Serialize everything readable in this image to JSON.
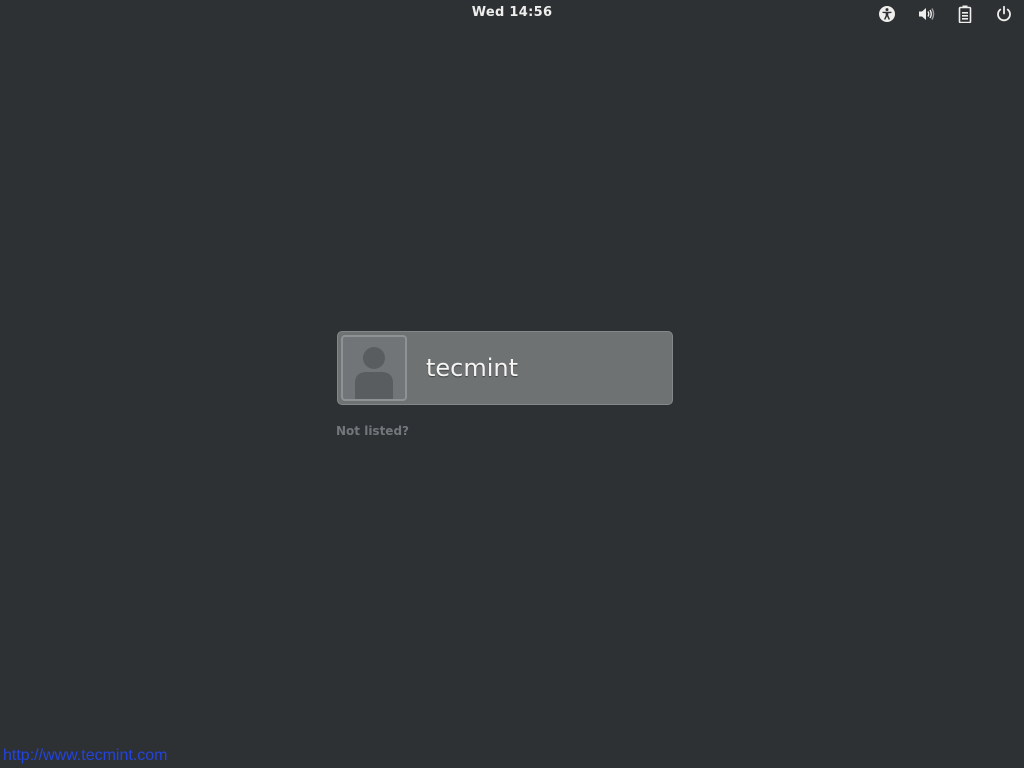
{
  "top_bar": {
    "clock": "Wed 14:56",
    "icons": [
      "accessibility-icon",
      "volume-icon",
      "battery-icon",
      "power-icon"
    ]
  },
  "login": {
    "users": [
      {
        "name": "tecmint",
        "avatar_icon": "user-avatar-icon"
      }
    ],
    "not_listed_label": "Not listed?"
  },
  "watermark": "http://www.tecmint.com",
  "colors": {
    "background": "#2e3134",
    "user_entry": "#6f7273",
    "text": "#eeeeec",
    "muted_text": "#72777b",
    "watermark": "#2244dd"
  }
}
